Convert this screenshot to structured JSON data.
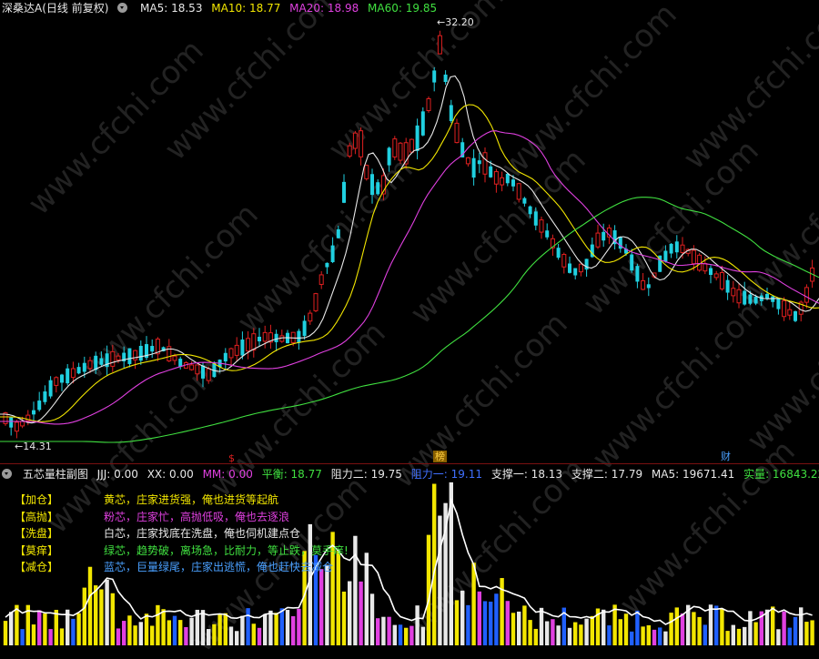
{
  "header": {
    "title": "深桑达A(日线 前复权)",
    "indicators": [
      {
        "label": "MA5: 18.53",
        "color": "#e8e8e8"
      },
      {
        "label": "MA10: 18.77",
        "color": "#f2e600"
      },
      {
        "label": "MA20: 18.98",
        "color": "#e040e0"
      },
      {
        "label": "MA60: 19.85",
        "color": "#40e040"
      }
    ]
  },
  "price_chart": {
    "high_label": "32.20",
    "low_label": "14.31",
    "markers": [
      {
        "text": "$",
        "color": "#e02020"
      },
      {
        "text": "榜",
        "color": "#f0c000"
      },
      {
        "text": "财",
        "color": "#4aa0ff"
      }
    ]
  },
  "sub_header": {
    "title": "五芯量柱副图",
    "items": [
      {
        "label": "JJJ: 0.00",
        "color": "#e8e8e8"
      },
      {
        "label": "XX: 0.00",
        "color": "#e8e8e8"
      },
      {
        "label": "MM: 0.00",
        "color": "#e040e0"
      },
      {
        "label": "平衡: 18.77",
        "color": "#40e040"
      },
      {
        "label": "阻力二: 19.75",
        "color": "#e8e8e8"
      },
      {
        "label": "阻力一: 19.11",
        "color": "#4070ff"
      },
      {
        "label": "支撑一: 18.13",
        "color": "#e8e8e8"
      },
      {
        "label": "支撑二: 17.79",
        "color": "#e8e8e8"
      },
      {
        "label": "MA5: 19671.41",
        "color": "#e8e8e8"
      },
      {
        "label": "实量: 16843.22",
        "color": "#40e040"
      }
    ]
  },
  "legend": [
    {
      "tag": "【加仓】",
      "text": "黄芯，庄家进货强，俺也进货等起航",
      "color": "#f2e600"
    },
    {
      "tag": "【高抛】",
      "text": "粉芯，庄家忙，高抛低吸，俺也去逐浪",
      "color": "#e040e0"
    },
    {
      "tag": "【洗盘】",
      "text": "白芯，庄家找底在洗盘，俺也伺机建点仓",
      "color": "#e8e8e8"
    },
    {
      "tag": "【莫痒】",
      "text": "绿芯，趋势破，离场急，比耐力，等止跌，莫手痒!",
      "color": "#40e040"
    },
    {
      "tag": "【减仓】",
      "text": "蓝芯，巨量绿尾，庄家出逃慌，俺也赶快去减仓",
      "color": "#4aa0ff"
    }
  ],
  "watermark": "www.cfchi.com",
  "colors": {
    "up": "#e02020",
    "down": "#20d0e0",
    "separator": "#7a1010"
  }
}
